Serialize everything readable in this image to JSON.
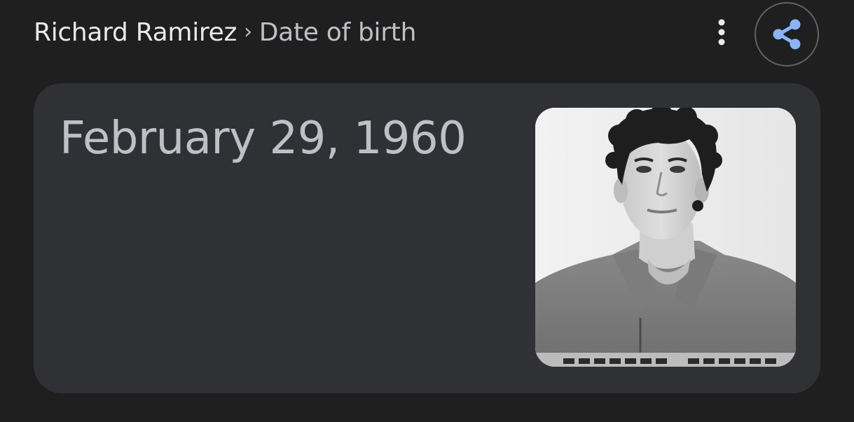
{
  "breadcrumb": {
    "parent": "Richard Ramirez",
    "separator": "›",
    "current": "Date of birth"
  },
  "answer": {
    "value": "February 29, 1960"
  },
  "icons": {
    "more": "more-vert-icon",
    "share": "share-icon"
  },
  "colors": {
    "background": "#1f1f20",
    "card": "#303134",
    "share_accent": "#8ab4f8"
  }
}
